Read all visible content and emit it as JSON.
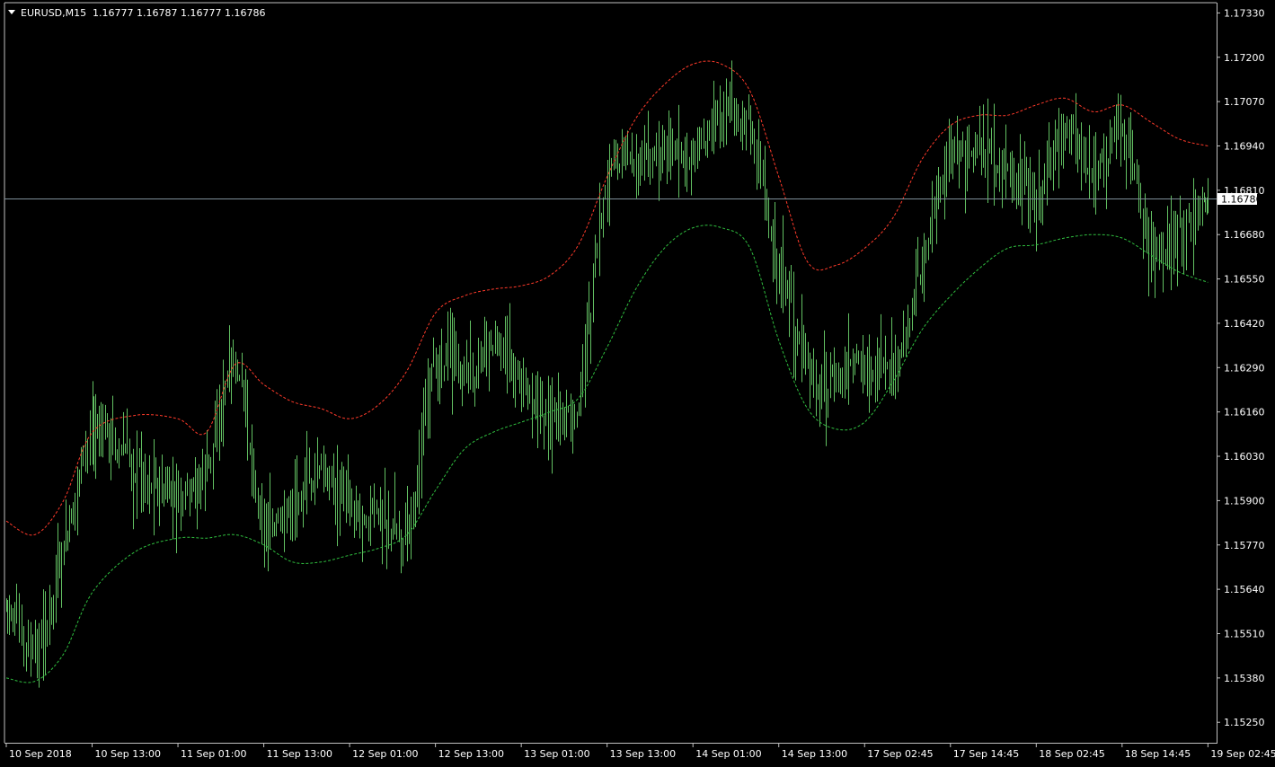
{
  "window": {
    "symbol_label": "EURUSD,M15",
    "ohlc_label": "1.16777 1.16787 1.16777 1.16786"
  },
  "colors": {
    "background": "#000000",
    "axis": "#c0c0c0",
    "bars": "#62c062",
    "upper_band": "#ff3a2a",
    "lower_band": "#2fbf3f",
    "price_line": "#7f8f99",
    "price_label_bg": "#ffffff",
    "price_label_text": "#000000"
  },
  "chart_data": {
    "type": "ohlc",
    "title": "EURUSD,M15",
    "ylim": [
      1.1519,
      1.1736
    ],
    "y_ticks": [
      "1.17330",
      "1.17200",
      "1.17070",
      "1.16940",
      "1.16810",
      "1.16680",
      "1.16550",
      "1.16420",
      "1.16290",
      "1.16160",
      "1.16030",
      "1.15900",
      "1.15770",
      "1.15640",
      "1.15510",
      "1.15380",
      "1.15250"
    ],
    "x_ticks": [
      "10 Sep 2018",
      "10 Sep 13:00",
      "11 Sep 01:00",
      "11 Sep 13:00",
      "12 Sep 01:00",
      "12 Sep 13:00",
      "13 Sep 01:00",
      "13 Sep 13:00",
      "14 Sep 01:00",
      "14 Sep 13:00",
      "17 Sep 02:45",
      "17 Sep 14:45",
      "18 Sep 02:45",
      "18 Sep 14:45",
      "19 Sep 02:45"
    ],
    "current_price": "1.16786",
    "price_path": [
      [
        "10 Sep 2018",
        1.156
      ],
      [
        "10 Sep 05:00",
        1.1545
      ],
      [
        "10 Sep 09:00",
        1.1575
      ],
      [
        "10 Sep 13:00",
        1.161
      ],
      [
        "10 Sep 18:00",
        1.16
      ],
      [
        "11 Sep 01:00",
        1.159
      ],
      [
        "11 Sep 05:00",
        1.16
      ],
      [
        "11 Sep 09:00",
        1.1628
      ],
      [
        "11 Sep 13:00",
        1.1582
      ],
      [
        "11 Sep 17:00",
        1.159
      ],
      [
        "11 Sep 21:00",
        1.1598
      ],
      [
        "12 Sep 01:00",
        1.159
      ],
      [
        "12 Sep 05:00",
        1.1585
      ],
      [
        "12 Sep 09:00",
        1.1583
      ],
      [
        "12 Sep 13:00",
        1.163
      ],
      [
        "12 Sep 17:00",
        1.1628
      ],
      [
        "12 Sep 21:00",
        1.1635
      ],
      [
        "13 Sep 01:00",
        1.1625
      ],
      [
        "13 Sep 05:00",
        1.1615
      ],
      [
        "13 Sep 08:00",
        1.162
      ],
      [
        "13 Sep 13:00",
        1.1685
      ],
      [
        "13 Sep 17:00",
        1.169
      ],
      [
        "13 Sep 21:00",
        1.1692
      ],
      [
        "14 Sep 01:00",
        1.1692
      ],
      [
        "14 Sep 04:00",
        1.1705
      ],
      [
        "14 Sep 08:00",
        1.1697
      ],
      [
        "14 Sep 13:00",
        1.166
      ],
      [
        "14 Sep 17:00",
        1.1628
      ],
      [
        "14 Sep 21:00",
        1.1625
      ],
      [
        "17 Sep 02:45",
        1.163
      ],
      [
        "17 Sep 06:45",
        1.1628
      ],
      [
        "17 Sep 10:45",
        1.166
      ],
      [
        "17 Sep 14:45",
        1.1692
      ],
      [
        "17 Sep 18:45",
        1.169
      ],
      [
        "17 Sep 22:45",
        1.1686
      ],
      [
        "18 Sep 02:45",
        1.1678
      ],
      [
        "18 Sep 06:45",
        1.17
      ],
      [
        "18 Sep 10:45",
        1.1685
      ],
      [
        "18 Sep 14:45",
        1.17
      ],
      [
        "18 Sep 18:45",
        1.1665
      ],
      [
        "18 Sep 22:45",
        1.1668
      ],
      [
        "19 Sep 02:45",
        1.1679
      ]
    ],
    "series": [
      {
        "name": "",
        "style": "dashed",
        "points": [
          [
            "10 Sep 2018",
            1.1584
          ],
          [
            "10 Sep 05:00",
            1.158
          ],
          [
            "10 Sep 09:00",
            1.159
          ],
          [
            "10 Sep 13:00",
            1.161
          ],
          [
            "10 Sep 18:00",
            1.1615
          ],
          [
            "11 Sep 01:00",
            1.1614
          ],
          [
            "11 Sep 05:00",
            1.161
          ],
          [
            "11 Sep 09:00",
            1.163
          ],
          [
            "11 Sep 13:00",
            1.1624
          ],
          [
            "11 Sep 17:00",
            1.1619
          ],
          [
            "11 Sep 21:00",
            1.1617
          ],
          [
            "12 Sep 01:00",
            1.1614
          ],
          [
            "12 Sep 05:00",
            1.1618
          ],
          [
            "12 Sep 09:00",
            1.1628
          ],
          [
            "12 Sep 13:00",
            1.1645
          ],
          [
            "12 Sep 17:00",
            1.165
          ],
          [
            "12 Sep 21:00",
            1.1652
          ],
          [
            "13 Sep 01:00",
            1.1653
          ],
          [
            "13 Sep 05:00",
            1.1656
          ],
          [
            "13 Sep 08:00",
            1.1665
          ],
          [
            "13 Sep 13:00",
            1.1685
          ],
          [
            "13 Sep 17:00",
            1.1702
          ],
          [
            "13 Sep 21:00",
            1.1712
          ],
          [
            "14 Sep 01:00",
            1.1718
          ],
          [
            "14 Sep 04:00",
            1.1718
          ],
          [
            "14 Sep 08:00",
            1.171
          ],
          [
            "14 Sep 13:00",
            1.1685
          ],
          [
            "14 Sep 17:00",
            1.166
          ],
          [
            "14 Sep 21:00",
            1.1659
          ],
          [
            "17 Sep 02:45",
            1.1664
          ],
          [
            "17 Sep 06:45",
            1.1673
          ],
          [
            "17 Sep 10:45",
            1.169
          ],
          [
            "17 Sep 14:45",
            1.17
          ],
          [
            "17 Sep 18:45",
            1.1703
          ],
          [
            "17 Sep 22:45",
            1.1703
          ],
          [
            "18 Sep 02:45",
            1.1706
          ],
          [
            "18 Sep 06:45",
            1.1708
          ],
          [
            "18 Sep 10:45",
            1.1704
          ],
          [
            "18 Sep 14:45",
            1.1706
          ],
          [
            "18 Sep 18:45",
            1.1701
          ],
          [
            "18 Sep 22:45",
            1.1696
          ],
          [
            "19 Sep 02:45",
            1.1694
          ]
        ]
      },
      {
        "name": "",
        "style": "dashed",
        "points": [
          [
            "10 Sep 2018",
            1.1538
          ],
          [
            "10 Sep 05:00",
            1.1537
          ],
          [
            "10 Sep 09:00",
            1.1545
          ],
          [
            "10 Sep 13:00",
            1.1563
          ],
          [
            "10 Sep 18:00",
            1.1575
          ],
          [
            "11 Sep 01:00",
            1.1579
          ],
          [
            "11 Sep 05:00",
            1.1579
          ],
          [
            "11 Sep 09:00",
            1.158
          ],
          [
            "11 Sep 13:00",
            1.1577
          ],
          [
            "11 Sep 17:00",
            1.1572
          ],
          [
            "11 Sep 21:00",
            1.1572
          ],
          [
            "12 Sep 01:00",
            1.1574
          ],
          [
            "12 Sep 05:00",
            1.1576
          ],
          [
            "12 Sep 09:00",
            1.158
          ],
          [
            "12 Sep 13:00",
            1.1593
          ],
          [
            "12 Sep 17:00",
            1.1605
          ],
          [
            "12 Sep 21:00",
            1.161
          ],
          [
            "13 Sep 01:00",
            1.1613
          ],
          [
            "13 Sep 05:00",
            1.1616
          ],
          [
            "13 Sep 08:00",
            1.162
          ],
          [
            "13 Sep 13:00",
            1.1635
          ],
          [
            "13 Sep 17:00",
            1.1652
          ],
          [
            "13 Sep 21:00",
            1.1664
          ],
          [
            "14 Sep 01:00",
            1.167
          ],
          [
            "14 Sep 04:00",
            1.167
          ],
          [
            "14 Sep 08:00",
            1.1664
          ],
          [
            "14 Sep 13:00",
            1.1637
          ],
          [
            "14 Sep 17:00",
            1.1617
          ],
          [
            "14 Sep 21:00",
            1.1611
          ],
          [
            "17 Sep 02:45",
            1.1613
          ],
          [
            "17 Sep 06:45",
            1.1625
          ],
          [
            "17 Sep 10:45",
            1.164
          ],
          [
            "17 Sep 14:45",
            1.165
          ],
          [
            "17 Sep 18:45",
            1.1658
          ],
          [
            "17 Sep 22:45",
            1.1664
          ],
          [
            "18 Sep 02:45",
            1.1665
          ],
          [
            "18 Sep 06:45",
            1.1667
          ],
          [
            "18 Sep 10:45",
            1.1668
          ],
          [
            "18 Sep 14:45",
            1.1667
          ],
          [
            "18 Sep 18:45",
            1.1662
          ],
          [
            "18 Sep 22:45",
            1.1657
          ],
          [
            "19 Sep 02:45",
            1.1654
          ]
        ]
      }
    ]
  }
}
